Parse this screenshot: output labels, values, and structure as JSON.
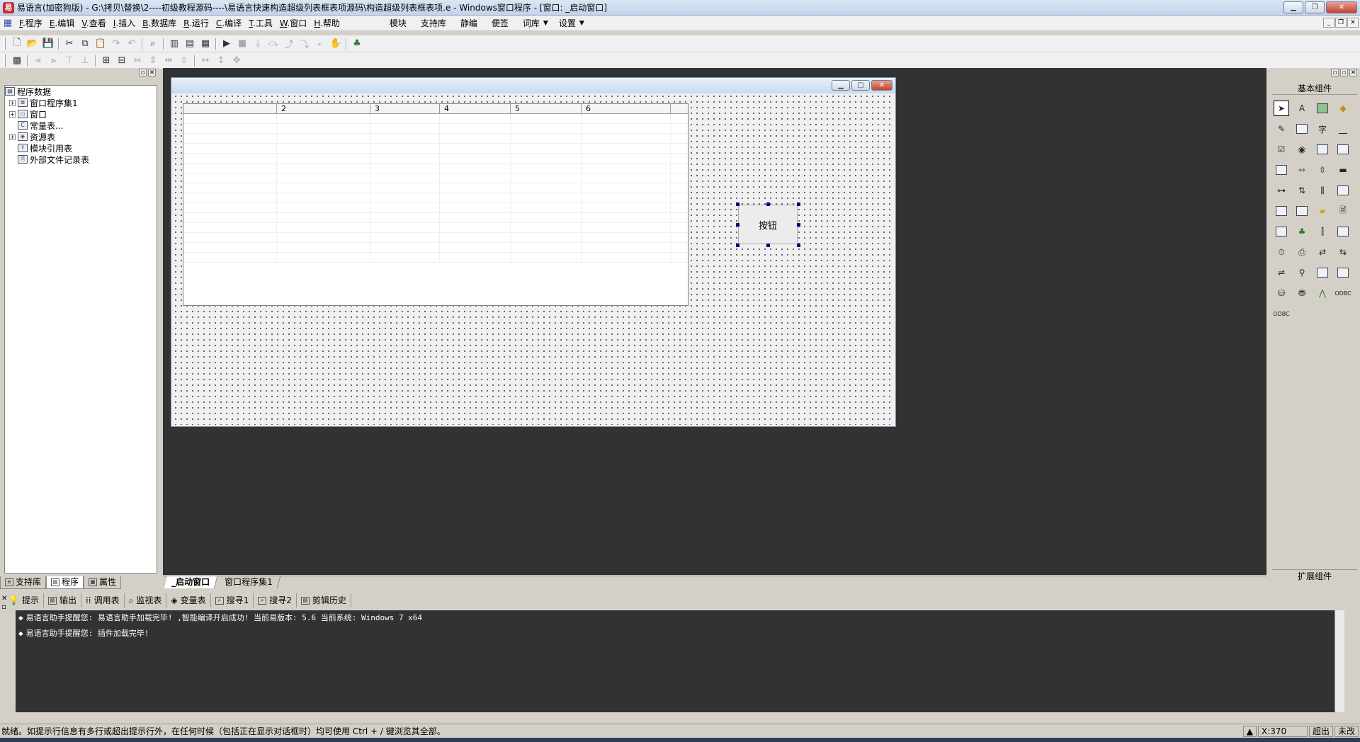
{
  "titlebar": {
    "title": "易语言(加密狗版) - G:\\拷贝\\替换\\2----初级教程源码----\\易语言快速构造超级列表框表项源码\\构造超级列表框表项.e - Windows窗口程序 - [窗口: _启动窗口]",
    "app_icon": "易"
  },
  "menubar": {
    "items": [
      {
        "key": "F",
        "label": ".程序"
      },
      {
        "key": "E",
        "label": ".编辑"
      },
      {
        "key": "V",
        "label": ".查看"
      },
      {
        "key": "I",
        "label": ".插入"
      },
      {
        "key": "B",
        "label": ".数据库"
      },
      {
        "key": "R",
        "label": ".运行"
      },
      {
        "key": "C",
        "label": ".编译"
      },
      {
        "key": "T",
        "label": ".工具"
      },
      {
        "key": "W",
        "label": ".窗口"
      },
      {
        "key": "H",
        "label": ".帮助"
      }
    ],
    "extra": [
      "模块",
      "支持库",
      "静编",
      "便签",
      "词库",
      "设置"
    ]
  },
  "tree": {
    "root": "程序数据",
    "items": [
      {
        "label": "窗口程序集1",
        "expander": "+"
      },
      {
        "label": "窗口",
        "expander": "+"
      },
      {
        "label": "常量表...",
        "expander": ""
      },
      {
        "label": "资源表",
        "expander": "+"
      },
      {
        "label": "模块引用表",
        "expander": ""
      },
      {
        "label": "外部文件记录表",
        "expander": ""
      }
    ]
  },
  "left_tabs": [
    "支持库",
    "程序",
    "属性"
  ],
  "design": {
    "columns": [
      "",
      "2",
      "3",
      "4",
      "5",
      "6"
    ],
    "button_label": "按钮"
  },
  "doc_tabs": [
    "_启动窗口",
    "窗口程序集1"
  ],
  "components": {
    "title": "基本组件",
    "ext_title": "扩展组件"
  },
  "bottom_tabs": [
    "提示",
    "输出",
    "调用表",
    "监视表",
    "变量表",
    "搜寻1",
    "搜寻2",
    "剪辑历史"
  ],
  "output_lines": [
    "易语言助手提醒您: 易语言助手加载完毕! ,智能编译开启成功! 当前易版本: 5.6 当前系统: Windows 7 x64",
    "易语言助手提醒您: 插件加载完毕!"
  ],
  "status": {
    "text": "就绪。如提示行信息有多行或超出提示行外，在任何时候（包括正在显示对话框时）均可使用 Ctrl + / 键浏览其全部。",
    "coord": "X:370",
    "mode1": "超出",
    "mode2": "未改"
  }
}
